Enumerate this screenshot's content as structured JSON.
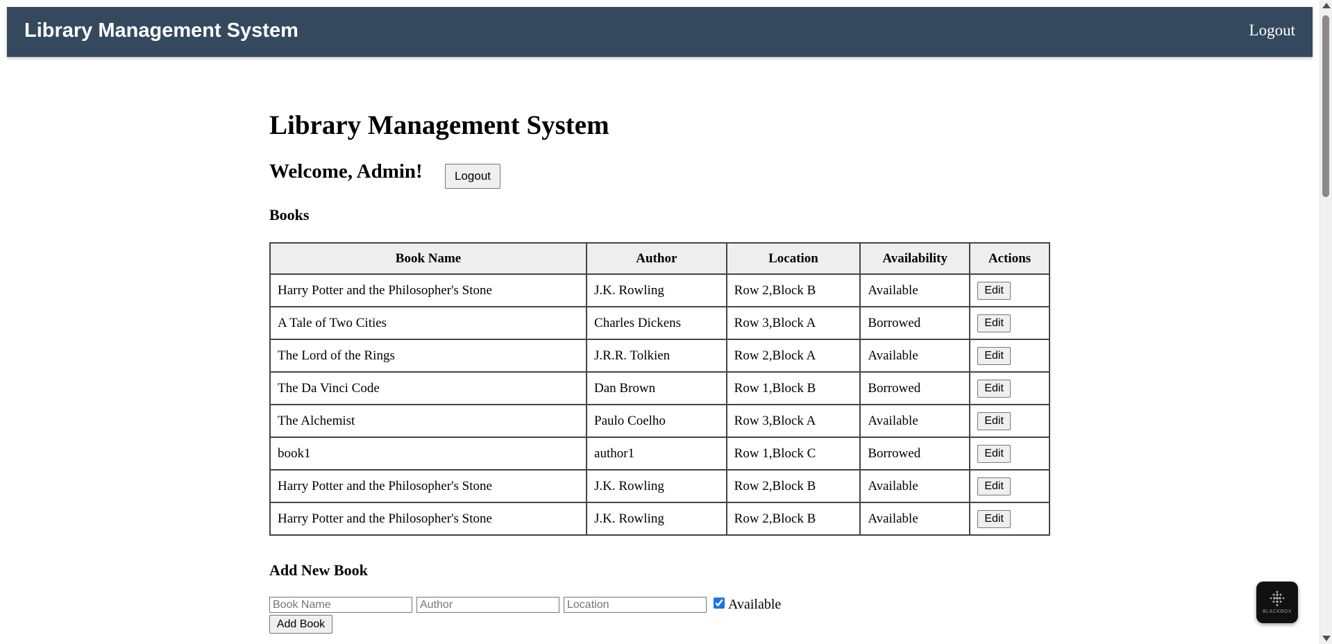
{
  "navbar": {
    "title": "Library Management System",
    "logout_label": "Logout",
    "background": "#34495e"
  },
  "page": {
    "title": "Library Management System",
    "welcome": "Welcome, Admin!",
    "logout_label": "Logout"
  },
  "books": {
    "heading": "Books",
    "columns": [
      "Book Name",
      "Author",
      "Location",
      "Availability",
      "Actions"
    ],
    "edit_label": "Edit",
    "rows": [
      {
        "name": "Harry Potter and the Philosopher's Stone",
        "author": "J.K. Rowling",
        "location": "Row 2,Block B",
        "availability": "Available"
      },
      {
        "name": "A Tale of Two Cities",
        "author": "Charles Dickens",
        "location": "Row 3,Block A",
        "availability": "Borrowed"
      },
      {
        "name": "The Lord of the Rings",
        "author": "J.R.R. Tolkien",
        "location": "Row 2,Block A",
        "availability": "Available"
      },
      {
        "name": "The Da Vinci Code",
        "author": "Dan Brown",
        "location": "Row 1,Block B",
        "availability": "Borrowed"
      },
      {
        "name": "The Alchemist",
        "author": "Paulo Coelho",
        "location": "Row 3,Block A",
        "availability": "Available"
      },
      {
        "name": "book1",
        "author": "author1",
        "location": "Row 1,Block C",
        "availability": "Borrowed"
      },
      {
        "name": "Harry Potter and the Philosopher's Stone",
        "author": "J.K. Rowling",
        "location": "Row 2,Block B",
        "availability": "Available"
      },
      {
        "name": "Harry Potter and the Philosopher's Stone",
        "author": "J.K. Rowling",
        "location": "Row 2,Block B",
        "availability": "Available"
      }
    ]
  },
  "add_book": {
    "heading": "Add New Book",
    "book_name_placeholder": "Book Name",
    "author_placeholder": "Author",
    "location_placeholder": "Location",
    "available_label": "Available",
    "available_checked": true,
    "submit_label": "Add Book"
  },
  "widget": {
    "label": "BLACKBOX",
    "icon": "blackbox-logo-icon"
  }
}
